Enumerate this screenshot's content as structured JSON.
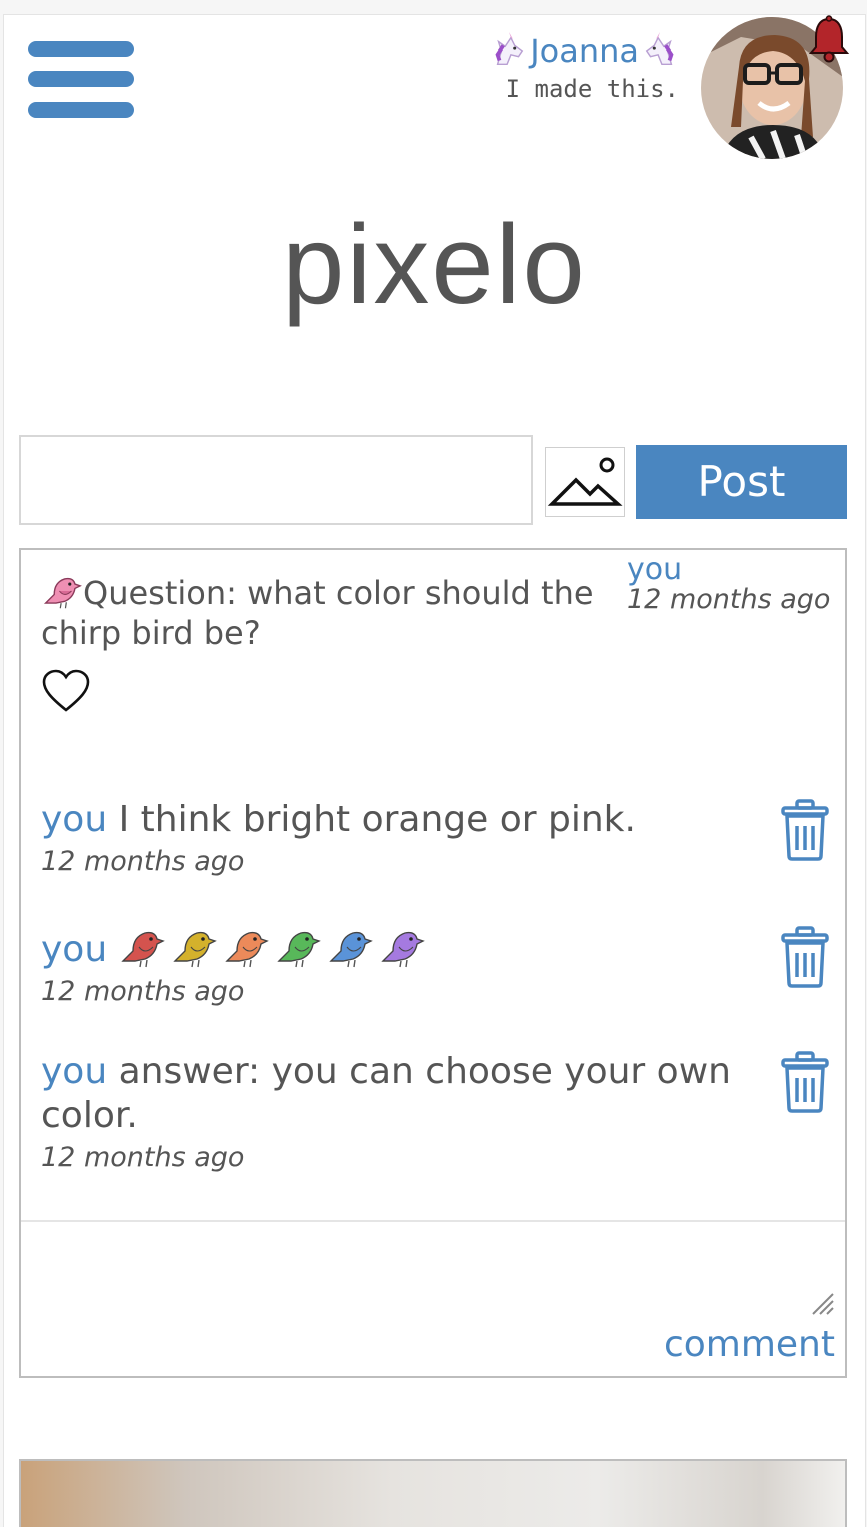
{
  "header": {
    "username": "Joanna",
    "tagline": "I made this."
  },
  "logo": "pixelo",
  "composer": {
    "post_label": "Post",
    "placeholder": ""
  },
  "post": {
    "text": "Question: what color should the chirp bird be?",
    "author": "you",
    "time": "12 months ago",
    "comments": [
      {
        "author": "you",
        "text": "I think bright orange or pink.",
        "time": "12 months ago"
      },
      {
        "author": "you",
        "text": "",
        "time": "12 months ago",
        "bird_colors": [
          "#d4534e",
          "#d4b12c",
          "#ec8a5a",
          "#58b85a",
          "#5a93d8",
          "#a57ae0"
        ]
      },
      {
        "author": "you",
        "text": "answer: you can choose your own color.",
        "time": "12 months ago"
      }
    ],
    "comment_label": "comment"
  },
  "colors": {
    "accent": "#4a86c0",
    "bell": "#b3252a",
    "text": "#555555"
  }
}
